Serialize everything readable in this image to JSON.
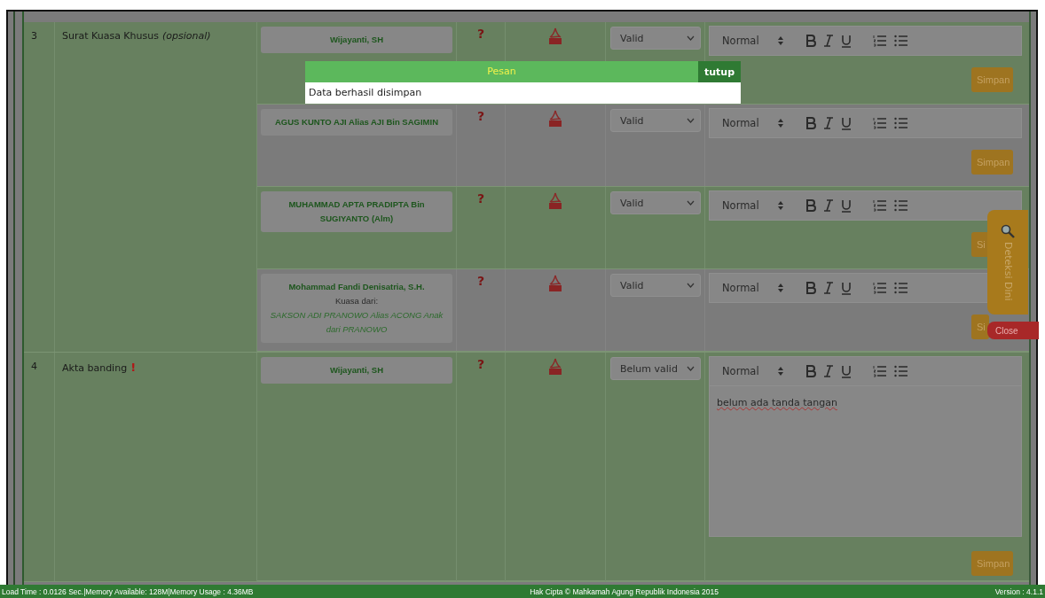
{
  "dialog": {
    "title": "Pesan",
    "close": "tutup",
    "message": "Data berhasil disimpan"
  },
  "rows": [
    {
      "number": "3",
      "document": "Surat Kuasa Khusus",
      "note": "(opsional)",
      "parties": [
        {
          "name": "Wijayanti, SH",
          "help": "?",
          "status": "Valid",
          "format": "Normal",
          "save": "Simpan"
        },
        {
          "name": "AGUS KUNTO AJI Alias AJI Bin SAGIMIN",
          "help": "?",
          "status": "Valid",
          "format": "Normal",
          "save": "Simpan"
        },
        {
          "name": "MUHAMMAD APTA PRADIPTA Bin SUGIYANTO (Alm)",
          "help": "?",
          "status": "Valid",
          "format": "Normal",
          "save": "Si"
        },
        {
          "name": "Mohammad Fandi Denisatria, S.H.",
          "proxy_label": "Kuasa dari:",
          "proxy_for": "SAKSON ADI PRANOWO Alias ACONG Anak dari PRANOWO",
          "help": "?",
          "status": "Valid",
          "format": "Normal",
          "save": "Si"
        }
      ]
    },
    {
      "number": "4",
      "document": "Akta banding",
      "flag": "!",
      "parties": [
        {
          "name": "Wijayanti, SH",
          "help": "?",
          "status": "Belum valid",
          "format": "Normal",
          "comment": "belum ada tanda tangan",
          "save": "Simpan"
        }
      ]
    }
  ],
  "side_tab": {
    "label": "Deteksi Dini",
    "close": "Close"
  },
  "footer": {
    "stats": "Load Time : 0.0126 Sec.|Memory Available: 128M|Memory Usage : 4.36MB",
    "copyright": "Hak Cipta © Mahkamah Agung Republik Indonesia 2015",
    "version": "Version : 4.1.1"
  }
}
